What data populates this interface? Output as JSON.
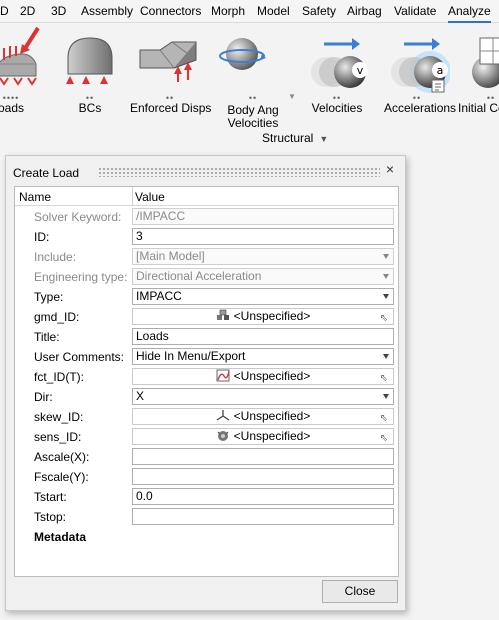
{
  "menu": {
    "items": [
      "D",
      "2D",
      "3D",
      "Assembly",
      "Connectors",
      "Morph",
      "Model",
      "Safety",
      "Airbag",
      "Validate",
      "Analyze"
    ],
    "active": "Analyze"
  },
  "ribbon": {
    "tools": [
      {
        "label": "oads",
        "icon": "loads-icon"
      },
      {
        "label": "BCs",
        "icon": "bcs-icon"
      },
      {
        "label": "Enforced Disps",
        "icon": "enforced-disps-icon"
      },
      {
        "label": "Body Ang\nVelocities",
        "icon": "body-ang-velocities-icon"
      },
      {
        "label": "Velocities",
        "icon": "velocities-icon"
      },
      {
        "label": "Accelerations",
        "icon": "accelerations-icon"
      },
      {
        "label": "Initial Co",
        "icon": "initial-conditions-icon"
      }
    ],
    "group_label": "Structural"
  },
  "dialog": {
    "title": "Create Load",
    "columns": {
      "name": "Name",
      "value": "Value"
    },
    "rows": [
      {
        "name": "Solver Keyword:",
        "value": "/IMPACC",
        "kind": "text",
        "disabled": true
      },
      {
        "name": "ID:",
        "value": "3",
        "kind": "text",
        "disabled": false
      },
      {
        "name": "Include:",
        "value": "[Main Model]",
        "kind": "combo",
        "disabled": true
      },
      {
        "name": "Engineering type:",
        "value": "Directional Acceleration",
        "kind": "combo",
        "disabled": true
      },
      {
        "name": "Type:",
        "value": "IMPACC",
        "kind": "combo",
        "disabled": false
      },
      {
        "name": "gmd_ID:",
        "value": "<Unspecified>",
        "kind": "entity",
        "icon": "group-icon",
        "disabled": false
      },
      {
        "name": "Title:",
        "value": "Loads",
        "kind": "text",
        "disabled": false
      },
      {
        "name": "User Comments:",
        "value": "Hide In Menu/Export",
        "kind": "combo",
        "disabled": false
      },
      {
        "name": "fct_ID(T):",
        "value": "<Unspecified>",
        "kind": "entity",
        "icon": "curve-icon",
        "disabled": false
      },
      {
        "name": "Dir:",
        "value": "X",
        "kind": "combo",
        "disabled": false
      },
      {
        "name": "skew_ID:",
        "value": "<Unspecified>",
        "kind": "entity",
        "icon": "system-icon",
        "disabled": false
      },
      {
        "name": "sens_ID:",
        "value": "<Unspecified>",
        "kind": "entity",
        "icon": "sensor-icon",
        "disabled": false
      },
      {
        "name": "Ascale(X):",
        "value": "",
        "kind": "text",
        "disabled": false
      },
      {
        "name": "Fscale(Y):",
        "value": "",
        "kind": "text",
        "disabled": false
      },
      {
        "name": "Tstart:",
        "value": "0.0",
        "kind": "text",
        "disabled": false
      },
      {
        "name": "Tstop:",
        "value": "",
        "kind": "text",
        "disabled": false
      }
    ],
    "section_label": "Metadata",
    "close_label": "Close",
    "close_icon": "×"
  },
  "colors": {
    "accent": "#2f73c9",
    "disabled_text": "#8a8a8a"
  }
}
